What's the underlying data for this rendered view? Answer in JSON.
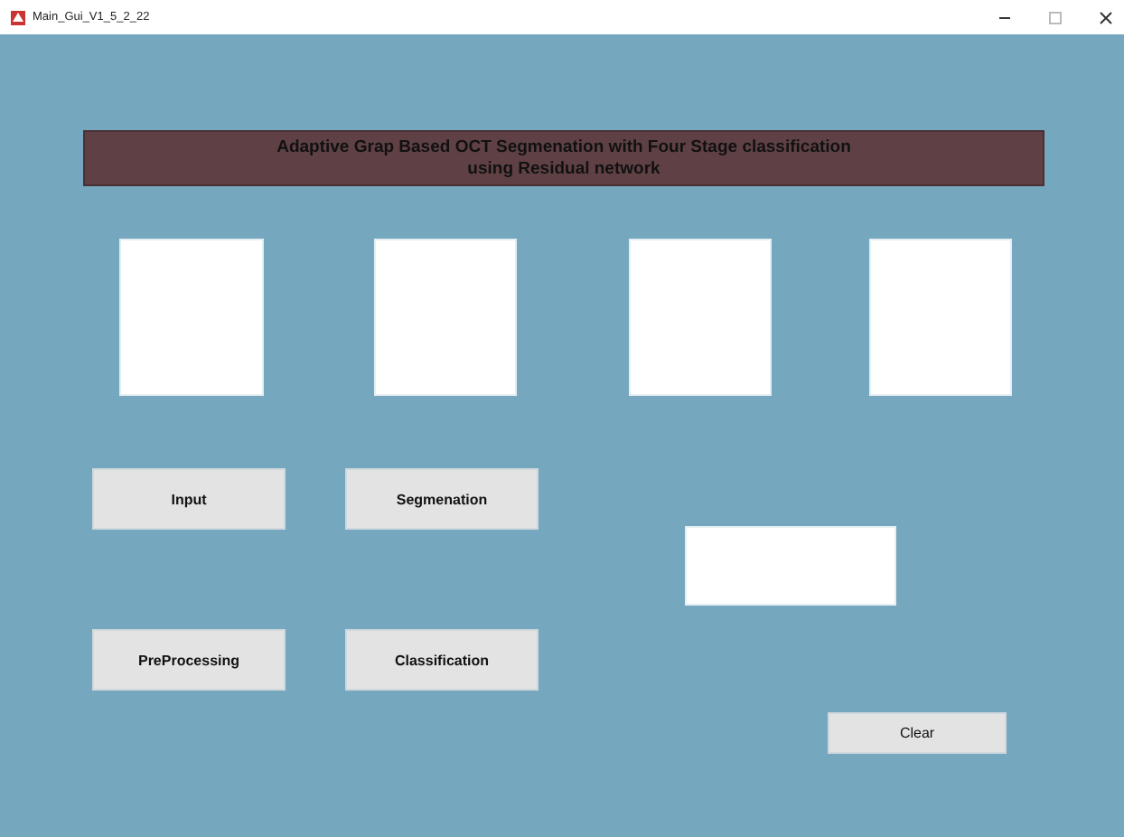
{
  "window": {
    "title": "Main_Gui_V1_5_2_22"
  },
  "banner": {
    "lines": [
      "Adaptive Grap Based OCT Segmenation with Four Stage classification",
      "using  Residual network"
    ]
  },
  "image_panels": [
    {
      "kind": "blank"
    },
    {
      "kind": "blank"
    },
    {
      "kind": "blank"
    },
    {
      "kind": "blank"
    }
  ],
  "buttons": [
    {
      "label": "Input"
    },
    {
      "label": "Segmenation"
    },
    {
      "label": "PreProcessing"
    },
    {
      "label": "Classification"
    }
  ],
  "result_box": {
    "kind": "blank"
  },
  "clear_button": {
    "label": "Clear"
  }
}
